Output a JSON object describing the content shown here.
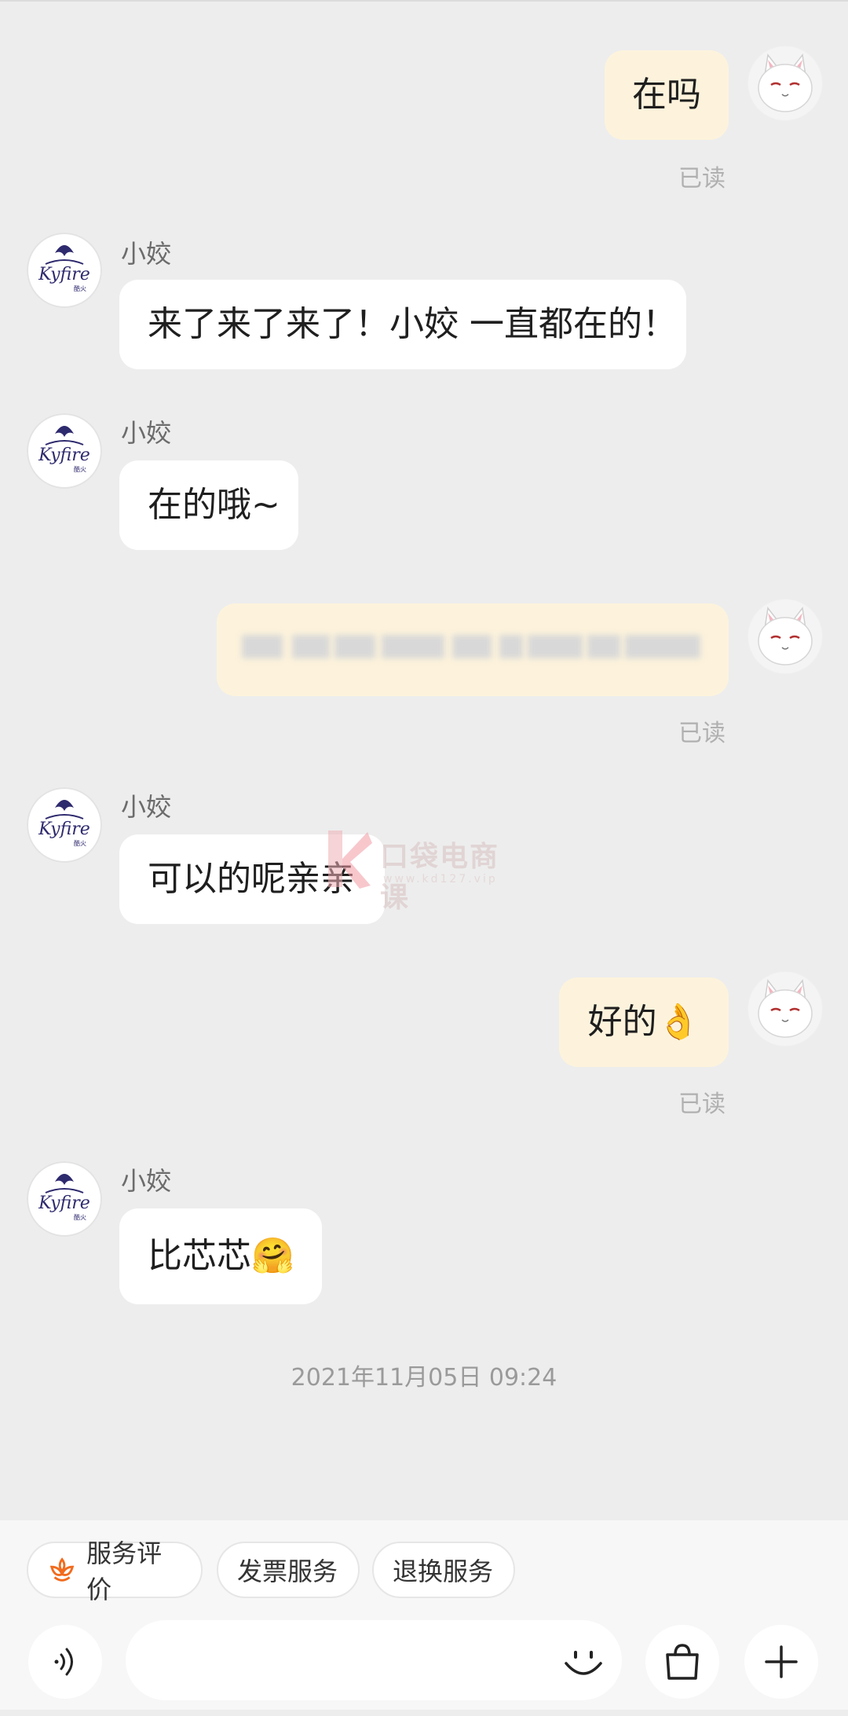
{
  "messages": [
    {
      "id": "m1",
      "side": "out",
      "text": "在吗",
      "read": "已读"
    },
    {
      "id": "m2",
      "side": "in",
      "name": "小姣",
      "text": "来了来了来了！小姣 一直都在的！"
    },
    {
      "id": "m3",
      "side": "in",
      "name": "小姣",
      "text": "在的哦~"
    },
    {
      "id": "m4",
      "side": "out",
      "text": "",
      "read": "已读"
    },
    {
      "id": "m5",
      "side": "in",
      "name": "小姣",
      "text": "可以的呢亲亲"
    },
    {
      "id": "m6",
      "side": "out",
      "text": "好的👌",
      "read": "已读"
    },
    {
      "id": "m7",
      "side": "in",
      "name": "小姣",
      "text": "比芯芯🤗"
    }
  ],
  "timestamp": "2021年11月05日 09:24",
  "watermark": {
    "text": "口袋电商课",
    "sub": "www.kd127.vip"
  },
  "quick_actions": [
    "服务评价",
    "发票服务",
    "退换服务"
  ],
  "input": {
    "placeholder": ""
  },
  "icons": {
    "voice": "voice-icon",
    "emoji": "emoji-icon",
    "bag": "shopping-bag-icon",
    "plus": "plus-icon",
    "service": "flower-icon"
  }
}
